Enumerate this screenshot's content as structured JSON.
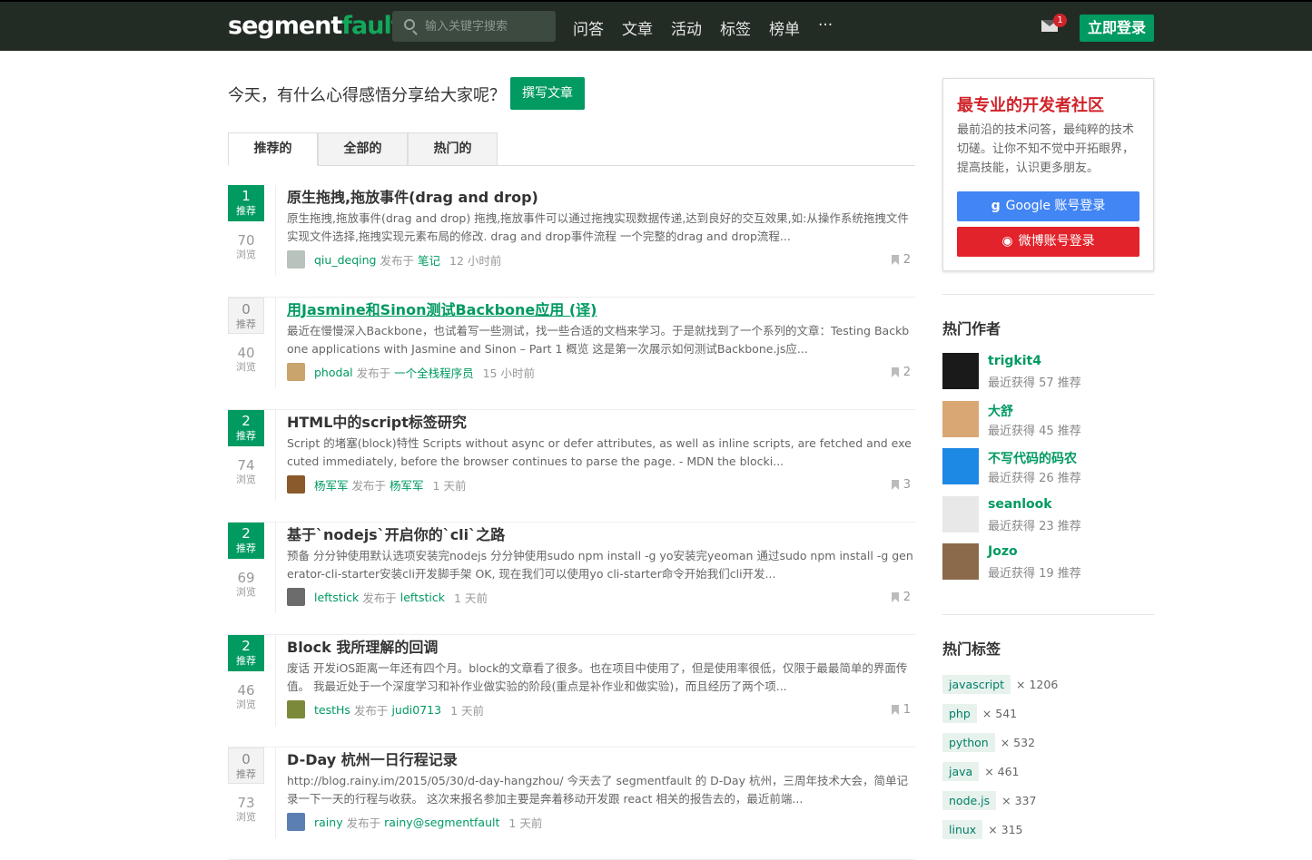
{
  "header": {
    "logo_part1": "segment",
    "logo_part2": "fault",
    "search_placeholder": "输入关键字搜索",
    "nav": [
      "问答",
      "文章",
      "活动",
      "标签",
      "榜单",
      "···"
    ],
    "mail_badge": "1",
    "login_label": "立即登录"
  },
  "main": {
    "prompt": "今天，有什么心得感悟分享给大家呢？",
    "write_label": "撰写文章",
    "tabs": [
      "推荐的",
      "全部的",
      "热门的"
    ],
    "vote_label": "推荐",
    "views_label": "浏览",
    "published_in": "发布于",
    "posts": [
      {
        "votes": "1",
        "views": "70",
        "title": "原生拖拽,拖放事件(drag and drop)",
        "excerpt": "原生拖拽,拖放事件(drag and drop) 拖拽,拖放事件可以通过拖拽实现数据传递,达到良好的交互效果,如:从操作系统拖拽文件实现文件选择,拖拽实现元素布局的修改. drag and drop事件流程 一个完整的drag and drop流程...",
        "author": "qiu_deqing",
        "column": "笔记",
        "time": "12 小时前",
        "bookmarks": "2"
      },
      {
        "votes": "0",
        "views": "40",
        "title": "用Jasmine和Sinon测试Backbone应用 (译)",
        "excerpt": "最近在慢慢深入Backbone，也试着写一些测试，找一些合适的文档来学习。于是就找到了一个系列的文章：Testing Backbone applications with Jasmine and Sinon – Part 1 概览 这是第一次展示如何测试Backbone.js应...",
        "author": "phodal",
        "column": "一个全栈程序员",
        "time": "15 小时前",
        "bookmarks": "2"
      },
      {
        "votes": "2",
        "views": "74",
        "title": "HTML中的script标签研究",
        "excerpt": "Script 的堵塞(block)特性 Scripts without async or defer attributes, as well as inline scripts, are fetched and executed immediately, before the browser continues to parse the page. - MDN the blocki...",
        "author": "杨军军",
        "column": "杨军军",
        "time": "1 天前",
        "bookmarks": "3"
      },
      {
        "votes": "2",
        "views": "69",
        "title": "基于`nodejs`开启你的`cli`之路",
        "excerpt": "预备 分分钟使用默认选项安装完nodejs 分分钟使用sudo npm install -g yo安装完yeoman 通过sudo npm install -g generator-cli-starter安装cli开发脚手架 OK, 现在我们可以使用yo cli-starter命令开始我们cli开发...",
        "author": "leftstick",
        "column": "leftstick",
        "time": "1 天前",
        "bookmarks": "2"
      },
      {
        "votes": "2",
        "views": "46",
        "title": "Block 我所理解的回调",
        "excerpt": "废话 开发iOS距离一年还有四个月。block的文章看了很多。也在项目中使用了，但是使用率很低，仅限于最最简单的界面传值。 我最近处于一个深度学习和补作业做实验的阶段(重点是补作业和做实验)，而且经历了两个项...",
        "author": "testHs",
        "column": "judi0713",
        "time": "1 天前",
        "bookmarks": "1"
      },
      {
        "votes": "0",
        "views": "73",
        "title": "D-Day 杭州一日行程记录",
        "excerpt": "http://blog.rainy.im/2015/05/30/d-day-hangzhou/ 今天去了 segmentfault 的 D-Day 杭州，三周年技术大会，简单记录一下一天的行程与收获。 这次来报名参加主要是奔着移动开发跟 react 相关的报告去的，最近前端...",
        "author": "rainy",
        "column": "rainy@segmentfault",
        "time": "1 天前",
        "bookmarks": ""
      }
    ]
  },
  "sidebar": {
    "box_title": "最专业的开发者社区",
    "box_desc": "最前沿的技术问答，最纯粹的技术切磋。让你不知不觉中开拓眼界，提高技能，认识更多朋友。",
    "google_label": "Google 账号登录",
    "weibo_label": "微博账号登录",
    "authors_title": "热门作者",
    "authors": [
      {
        "name": "trigkit4",
        "recent": "最近获得 57 推荐"
      },
      {
        "name": "大舒",
        "recent": "最近获得 45 推荐"
      },
      {
        "name": "不写代码的码农",
        "recent": "最近获得 26 推荐"
      },
      {
        "name": "seanlook",
        "recent": "最近获得 23 推荐"
      },
      {
        "name": "Jozo",
        "recent": "最近获得 19 推荐"
      }
    ],
    "tags_title": "热门标签",
    "tags": [
      {
        "name": "javascript",
        "count": "× 1206"
      },
      {
        "name": "php",
        "count": "× 541"
      },
      {
        "name": "python",
        "count": "× 532"
      },
      {
        "name": "java",
        "count": "× 461"
      },
      {
        "name": "node.js",
        "count": "× 337"
      },
      {
        "name": "linux",
        "count": "× 315"
      }
    ]
  },
  "colors": {
    "brand": "#019a61",
    "header_bg": "#222b24",
    "accent_red": "#d0232a",
    "google_blue": "#4285f4"
  }
}
